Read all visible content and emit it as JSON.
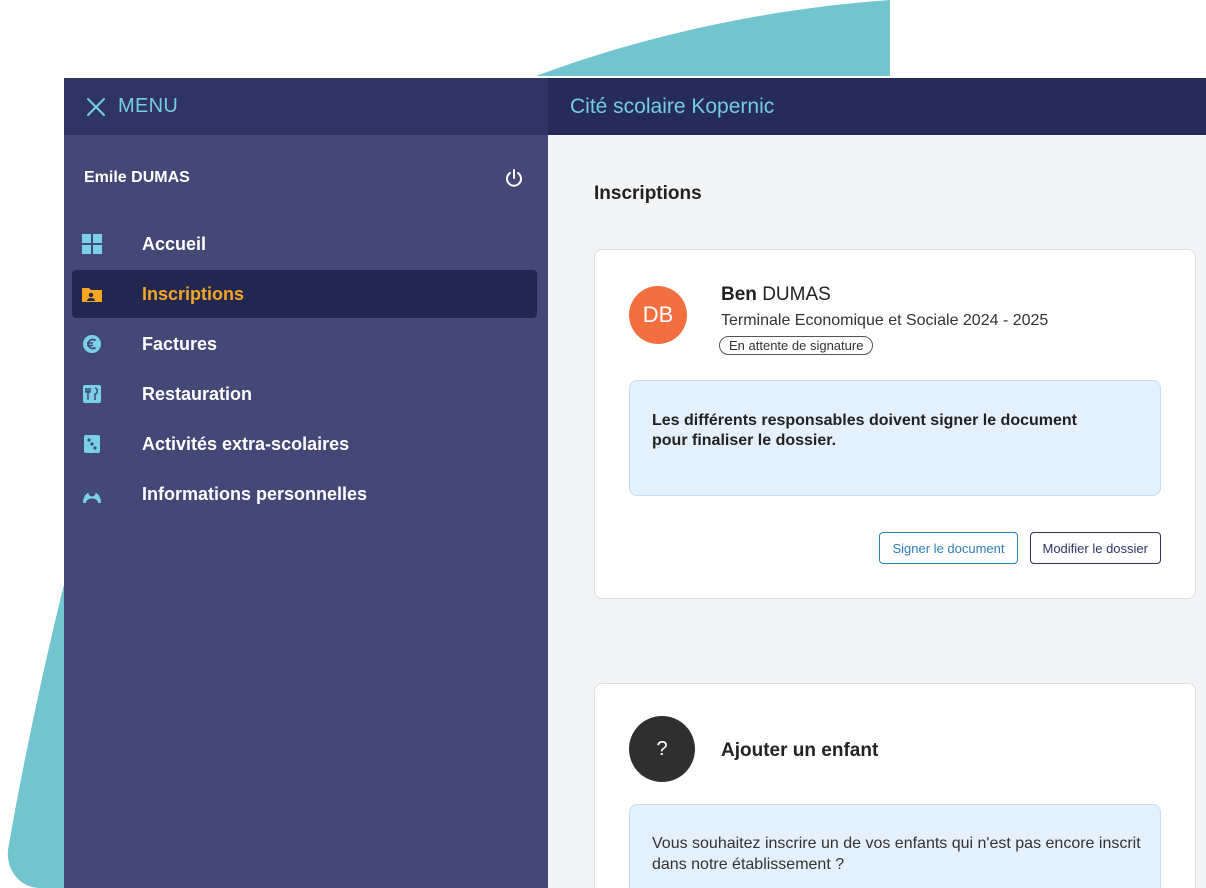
{
  "sidebar": {
    "menu_label": "MENU",
    "user_name": "Emile DUMAS",
    "items": [
      {
        "label": "Accueil",
        "active": false
      },
      {
        "label": "Inscriptions",
        "active": true
      },
      {
        "label": "Factures",
        "active": false
      },
      {
        "label": "Restauration",
        "active": false
      },
      {
        "label": "Activités extra-scolaires",
        "active": false
      },
      {
        "label": "Informations personnelles",
        "active": false
      }
    ]
  },
  "header": {
    "title": "Cité scolaire Kopernic"
  },
  "main": {
    "page_title": "Inscriptions",
    "enrollment": {
      "avatar_initials": "DB",
      "first_name": "Ben",
      "last_name": "DUMAS",
      "class_label": "Terminale Economique et Sociale 2024 - 2025",
      "status": "En attente de signature",
      "info_message": "Les différents responsables doivent signer le document pour finaliser le dossier.",
      "sign_button": "Signer le document",
      "edit_button": "Modifier le dossier"
    },
    "add_child": {
      "icon_glyph": "?",
      "title": "Ajouter un enfant",
      "info_message": "Vous souhaitez inscrire un de vos enfants qui n'est pas encore inscrit dans notre établissement ?"
    }
  },
  "colors": {
    "sidebar_bg": "#434877",
    "header_bg": "#262b57",
    "accent": "#72cee0",
    "active_item": "#f5a623",
    "avatar_bg": "#f36f3f"
  }
}
